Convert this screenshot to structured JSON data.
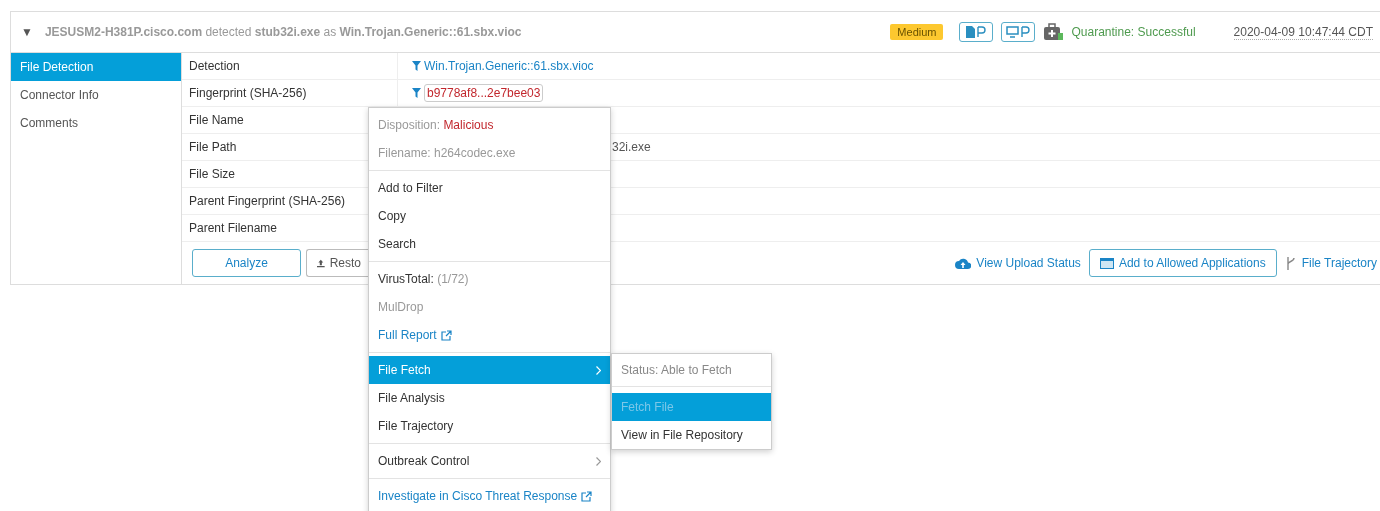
{
  "event": {
    "toggle": "▼",
    "summary": "**JESUSM2-H381P.cisco.com** detected **stub32i.exe** as **Win.Trojan.Generic::61.sbx.vioc**",
    "severity": "Medium",
    "quarantine": "Quarantine: Successful",
    "timestamp": "2020-04-09 10:47:44 CDT"
  },
  "nav": [
    {
      "label": "File Detection",
      "selected": true
    },
    {
      "label": "Connector Info",
      "selected": false
    },
    {
      "label": "Comments",
      "selected": false
    }
  ],
  "rows": [
    {
      "label": "Detection",
      "value": "Win.Trojan.Generic::61.sbx.vioc",
      "kind": "filter-link"
    },
    {
      "label": "Fingerprint (SHA-256)",
      "value": "b9778af8...2e7bee03",
      "kind": "filter-hash"
    },
    {
      "label": "File Name",
      "kind": "empty"
    },
    {
      "label": "File Path",
      "value": "32i.exe",
      "kind": "partial"
    },
    {
      "label": "File Size",
      "kind": "empty"
    },
    {
      "label": "Parent Fingerprint (SHA-256)",
      "kind": "empty"
    },
    {
      "label": "Parent Filename",
      "kind": "empty"
    }
  ],
  "actions": {
    "analyze": "Analyze",
    "restore": "Resto",
    "upload_status": "View Upload Status",
    "allow": "Add to Allowed Applications",
    "trajectory": "File Trajectory"
  },
  "menu": {
    "sections": [
      [
        {
          "kind": "pair-alert",
          "label": "Disposition:",
          "value": "Malicious"
        },
        {
          "kind": "muted",
          "label": "Filename: h264codec.exe"
        }
      ],
      [
        {
          "kind": "item",
          "label": "Add to Filter",
          "selected": false
        },
        {
          "kind": "item",
          "label": "Copy",
          "selected": false
        },
        {
          "kind": "item",
          "label": "Search",
          "selected": false
        }
      ],
      [
        {
          "kind": "pair",
          "label": "VirusTotal:",
          "value": "(1/72)"
        },
        {
          "kind": "muted",
          "label": "MulDrop"
        },
        {
          "kind": "link",
          "label": "Full Report"
        }
      ],
      [
        {
          "kind": "submenu",
          "label": "File Fetch",
          "selected": true
        },
        {
          "kind": "item",
          "label": "File Analysis",
          "selected": false
        },
        {
          "kind": "item",
          "label": "File Trajectory",
          "selected": false
        }
      ],
      [
        {
          "kind": "submenu",
          "label": "Outbreak Control",
          "selected": false
        }
      ],
      [
        {
          "kind": "link",
          "label": "Investigate in Cisco Threat Response"
        }
      ]
    ]
  },
  "submenu": {
    "status": "Status: Able to Fetch",
    "items": [
      {
        "label": "Fetch File",
        "selected": true,
        "disabled": true
      },
      {
        "label": "View in File Repository",
        "selected": false,
        "disabled": false
      }
    ]
  }
}
